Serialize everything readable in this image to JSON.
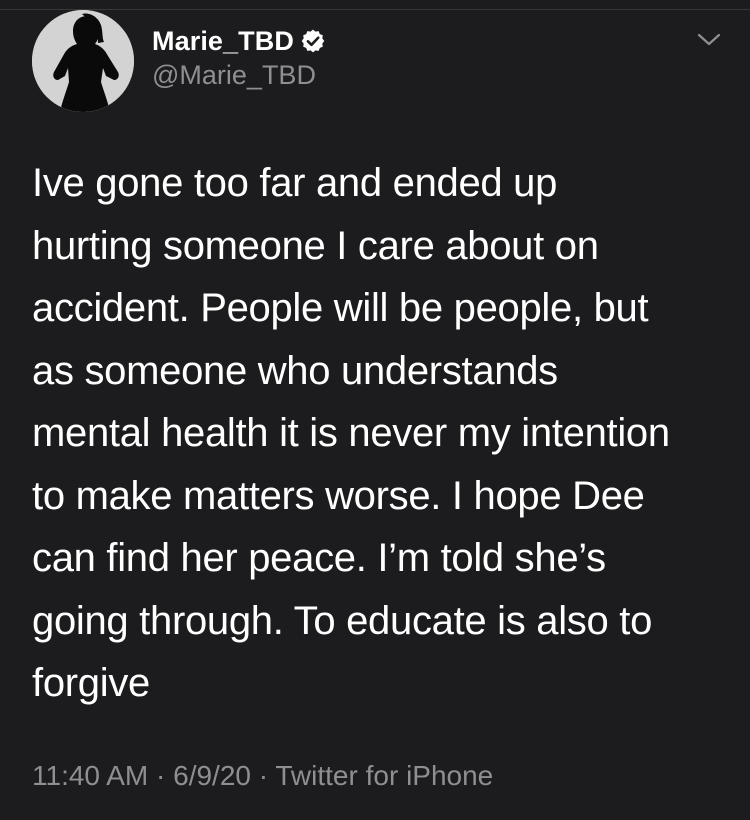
{
  "tweet": {
    "display_name": "Marie_TBD",
    "handle": "@Marie_TBD",
    "lines": [
      "Ive gone too far and ended up",
      "hurting someone I care about on",
      "accident. People will be people, but",
      "as someone who understands",
      "mental health it is never my intention",
      "to make matters worse. I hope Dee",
      "can find her peace. I’m told she’s",
      "going through. To educate is also to",
      "forgive"
    ],
    "time": "11:40 AM",
    "date": "6/9/20",
    "source": "Twitter for iPhone",
    "separator": "·"
  },
  "icons": {
    "verified": "verified-badge-icon",
    "menu": "chevron-down-icon"
  },
  "colors": {
    "background": "#1c1c1e",
    "text": "#ffffff",
    "secondary_text": "#8e8e93"
  }
}
